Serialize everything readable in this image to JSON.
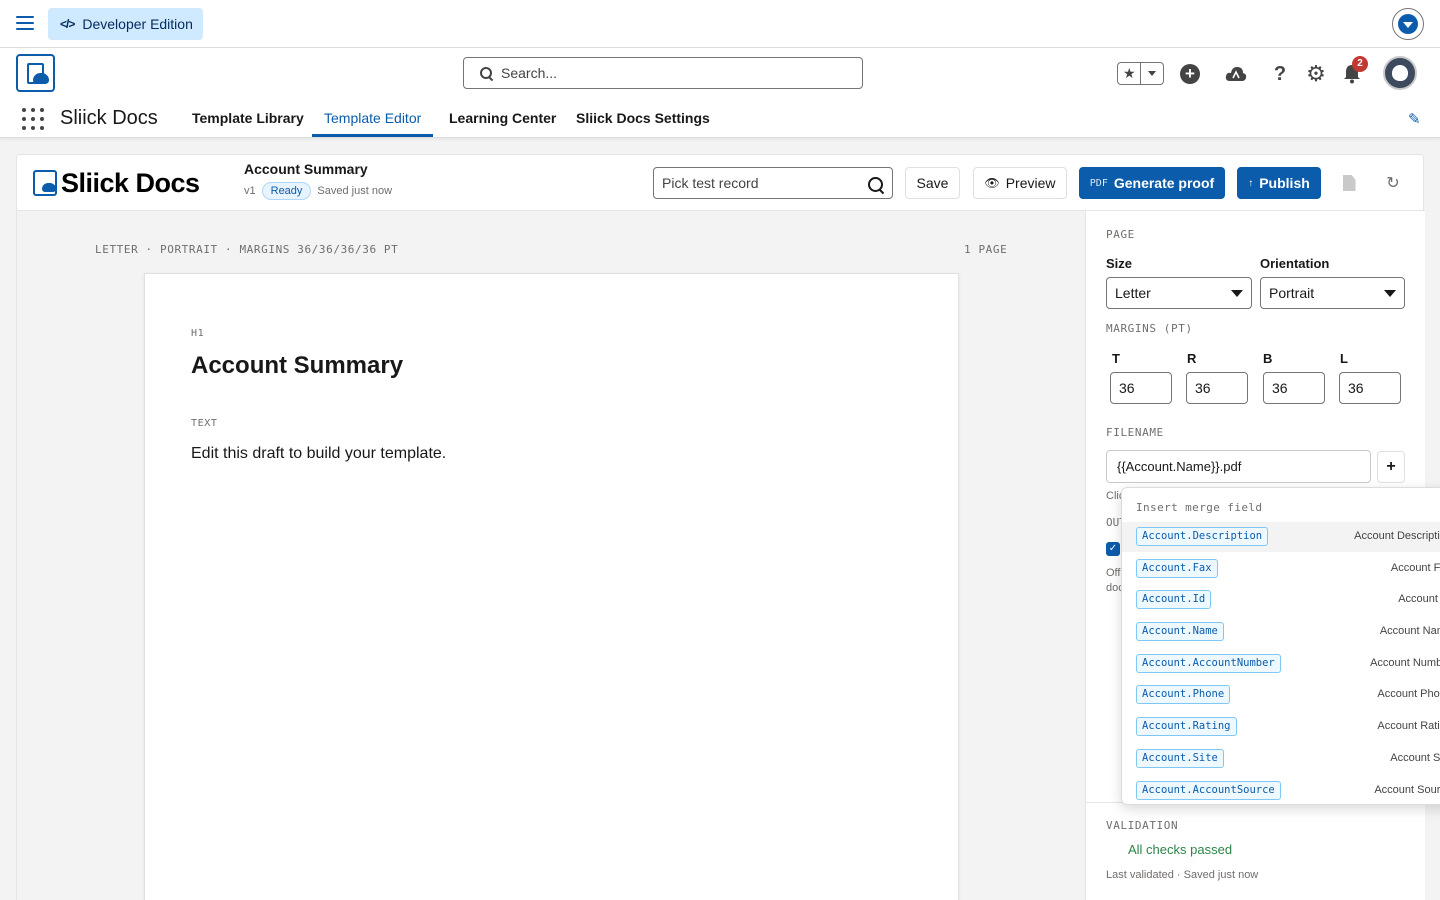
{
  "global": {
    "edition_badge": "Developer Edition",
    "search_placeholder": "Search...",
    "notifications_count": "2"
  },
  "nav": {
    "app_name": "Sliick Docs",
    "items": [
      "Template Library",
      "Template Editor",
      "Learning Center",
      "Sliick Docs Settings"
    ],
    "active": "Template Editor"
  },
  "editor": {
    "brand": "Sliick Docs",
    "doc_title": "Account Summary",
    "version": "v1",
    "status": "Ready",
    "saved": "Saved just now",
    "pick_placeholder": "Pick test record",
    "save_label": "Save",
    "preview_label": "Preview",
    "proof_tag": "PDF",
    "proof_label": "Generate proof",
    "publish_label": "Publish"
  },
  "canvas": {
    "meta": "LETTER · PORTRAIT · MARGINS 36/36/36/36 PT",
    "page_count": "1 PAGE",
    "blocks": [
      {
        "label": "H1",
        "text": "Account Summary"
      },
      {
        "label": "TEXT",
        "text": "Edit this draft to build your template."
      }
    ]
  },
  "panel": {
    "page_section": "PAGE",
    "size_label": "Size",
    "size_value": "Letter",
    "orientation_label": "Orientation",
    "orientation_value": "Portrait",
    "margins_section": "MARGINS (PT)",
    "margins": [
      {
        "label": "T",
        "value": "36"
      },
      {
        "label": "R",
        "value": "36"
      },
      {
        "label": "B",
        "value": "36"
      },
      {
        "label": "L",
        "value": "36"
      }
    ],
    "filename_section": "FILENAME",
    "filename_value": "{{Account.Name}}.pdf",
    "peek_click": "Clic",
    "peek_out": "OUT",
    "peek_off": "Off",
    "peek_doc": "doc",
    "validation_section": "VALIDATION",
    "validation_ok": "All checks passed",
    "validation_sub": "Last validated · Saved just now"
  },
  "merge": {
    "title": "Insert merge field",
    "fields": [
      {
        "field": "Account.Description",
        "desc": "Account Description"
      },
      {
        "field": "Account.Fax",
        "desc": "Account Fax"
      },
      {
        "field": "Account.Id",
        "desc": "Account ID"
      },
      {
        "field": "Account.Name",
        "desc": "Account Name"
      },
      {
        "field": "Account.AccountNumber",
        "desc": "Account Number"
      },
      {
        "field": "Account.Phone",
        "desc": "Account Phone"
      },
      {
        "field": "Account.Rating",
        "desc": "Account Rating"
      },
      {
        "field": "Account.Site",
        "desc": "Account Site"
      },
      {
        "field": "Account.AccountSource",
        "desc": "Account Source"
      }
    ]
  },
  "icons": {
    "menu": "hamburger-icon",
    "dev": "code-icon",
    "search": "search-icon",
    "favorites": "star-icon",
    "add": "plus-icon",
    "trailhead": "cloud-icon",
    "help": "question-icon",
    "setup": "gear-icon",
    "notifications": "bell-icon",
    "edit": "pencil-icon",
    "preview": "eye-icon",
    "upload": "arrow-up-icon",
    "file": "file-icon",
    "refresh": "refresh-icon"
  },
  "colors": {
    "brand": "#0b5cab",
    "success": "#2e844a",
    "badge": "#c23934"
  }
}
